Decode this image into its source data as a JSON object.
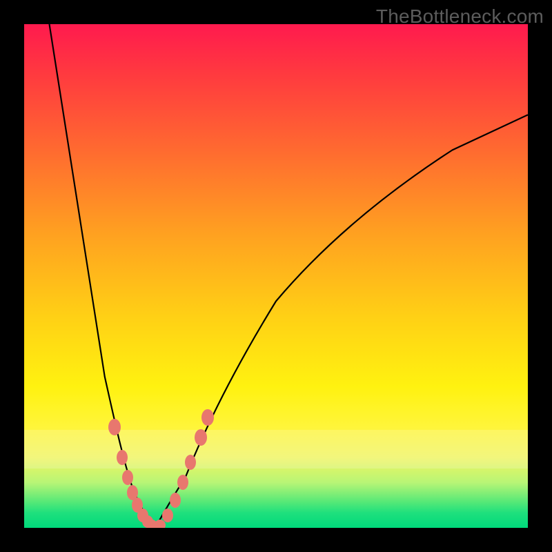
{
  "watermark": "TheBottleneck.com",
  "chart_data": {
    "type": "line",
    "title": "",
    "xlabel": "",
    "ylabel": "",
    "xlim": [
      0,
      100
    ],
    "ylim": [
      0,
      100
    ],
    "grid": false,
    "legend": false,
    "series": [
      {
        "name": "curve-left",
        "x": [
          5,
          8,
          12,
          16,
          18,
          20,
          22,
          24,
          25,
          26
        ],
        "y": [
          100,
          80,
          55,
          30,
          18,
          10,
          5,
          2,
          0.8,
          0
        ]
      },
      {
        "name": "curve-right",
        "x": [
          26,
          27,
          29,
          32,
          36,
          42,
          50,
          60,
          72,
          85,
          100
        ],
        "y": [
          0,
          1,
          4,
          10,
          20,
          32,
          45,
          57,
          67,
          75,
          82
        ]
      }
    ],
    "markers": [
      {
        "series": "curve-left",
        "x": 18.0,
        "y": 20
      },
      {
        "series": "curve-left",
        "x": 19.5,
        "y": 14
      },
      {
        "series": "curve-left",
        "x": 20.5,
        "y": 10
      },
      {
        "series": "curve-left",
        "x": 21.5,
        "y": 7
      },
      {
        "series": "curve-left",
        "x": 22.5,
        "y": 4.5
      },
      {
        "series": "curve-left",
        "x": 23.5,
        "y": 2.5
      },
      {
        "series": "curve-left",
        "x": 24.5,
        "y": 1.2
      },
      {
        "series": "curve-left",
        "x": 25.3,
        "y": 0.5
      },
      {
        "series": "curve-left",
        "x": 26.0,
        "y": 0
      },
      {
        "series": "curve-right",
        "x": 27.0,
        "y": 0.5
      },
      {
        "series": "curve-right",
        "x": 28.5,
        "y": 2.5
      },
      {
        "series": "curve-right",
        "x": 30.0,
        "y": 5.5
      },
      {
        "series": "curve-right",
        "x": 31.5,
        "y": 9
      },
      {
        "series": "curve-right",
        "x": 33.0,
        "y": 13
      },
      {
        "series": "curve-right",
        "x": 35.0,
        "y": 18
      },
      {
        "series": "curve-right",
        "x": 36.5,
        "y": 22
      }
    ],
    "background_gradient": {
      "direction": "vertical",
      "stops": [
        {
          "pos": 0.0,
          "color": "#ff1a4e"
        },
        {
          "pos": 0.25,
          "color": "#ff6a30"
        },
        {
          "pos": 0.55,
          "color": "#ffd015"
        },
        {
          "pos": 0.8,
          "color": "#fff53a"
        },
        {
          "pos": 1.0,
          "color": "#00d97b"
        }
      ]
    }
  }
}
